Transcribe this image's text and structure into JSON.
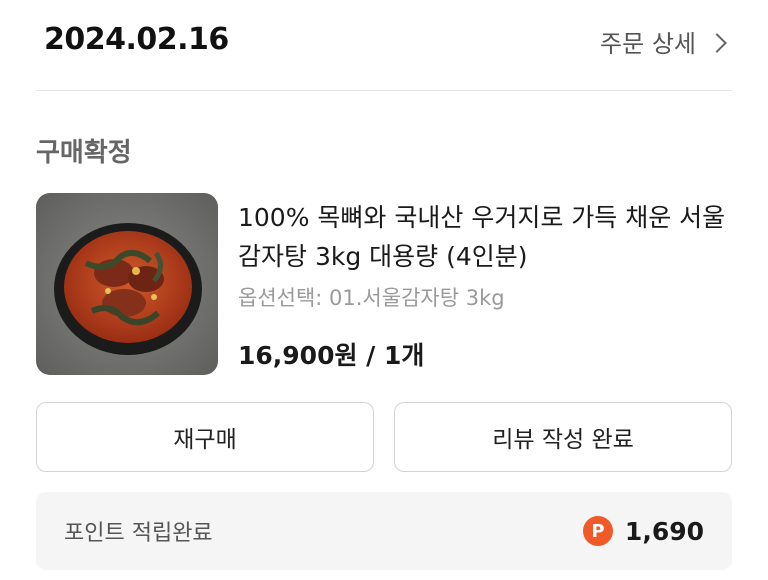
{
  "order": {
    "date": "2024.02.16",
    "detail_link": "주문 상세"
  },
  "status": "구매확정",
  "product": {
    "title": "100% 목뼈와 국내산 우거지로 가득 채운 서울 감자탕 3kg 대용량 (4인분)",
    "option": "옵션선택: 01.서울감자탕 3kg",
    "price": "16,900원 / 1개"
  },
  "buttons": {
    "rebuy": "재구매",
    "review": "리뷰 작성 완료"
  },
  "points": {
    "label": "포인트 적립완료",
    "icon_letter": "P",
    "value": "1,690",
    "icon_color": "#f05a28"
  }
}
